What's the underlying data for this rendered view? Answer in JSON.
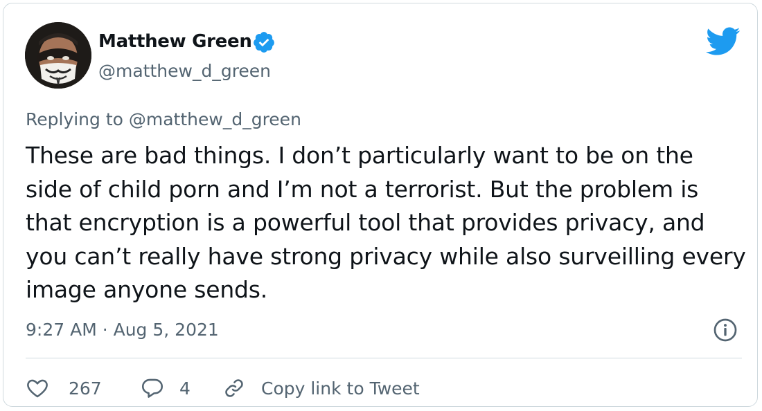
{
  "tweet": {
    "author": {
      "display_name": "Matthew Green",
      "handle": "@matthew_d_green",
      "verified": true,
      "avatar_icon": "masked-man-avatar"
    },
    "replying_to": "Replying to @matthew_d_green",
    "text": "These are bad things. I don’t particularly want to be on the side of child porn and I’m not a terrorist. But the problem is that encryption is a powerful tool that provides privacy, and you can’t really have strong privacy while also surveilling every image anyone sends.",
    "timestamp": "9:27 AM · Aug 5, 2021"
  },
  "actions": {
    "like_count": "267",
    "reply_count": "4",
    "copy_link_label": "Copy link to Tweet"
  },
  "icons": {
    "brand": "twitter-bird-icon",
    "verified": "verified-badge-icon",
    "info": "info-icon",
    "like": "heart-icon",
    "reply": "speech-bubble-icon",
    "link": "chain-link-icon"
  },
  "colors": {
    "brand_blue": "#1d9bf0",
    "text_primary": "#0f1419",
    "text_secondary": "#536471",
    "border": "#cfd9de"
  }
}
